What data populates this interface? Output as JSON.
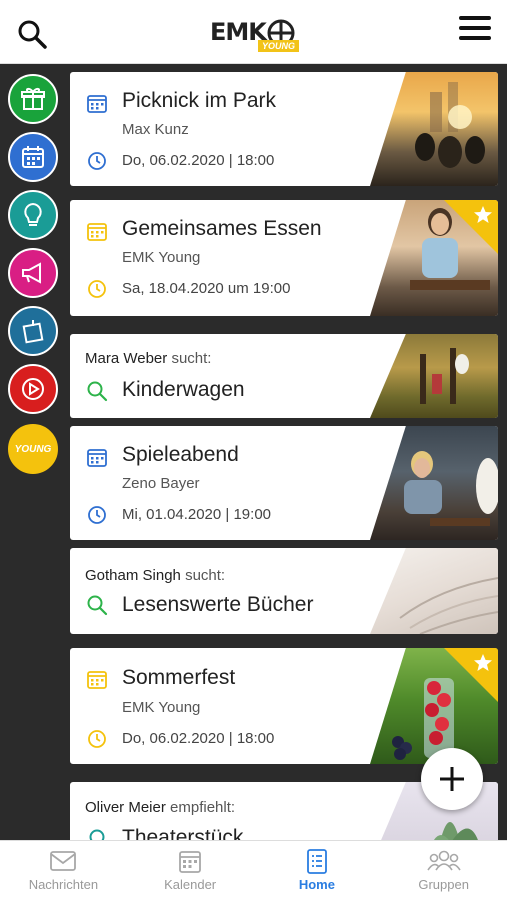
{
  "header": {
    "logo_text": "EMK",
    "logo_badge": "YOUNG"
  },
  "sidebar": {
    "items": [
      {
        "icon": "gift-icon",
        "color": "#19a33b"
      },
      {
        "icon": "calendar-icon",
        "color": "#2f6fd1"
      },
      {
        "icon": "lightbulb-icon",
        "color": "#1a9c96"
      },
      {
        "icon": "megaphone-icon",
        "color": "#d91e84"
      },
      {
        "icon": "note-icon",
        "color": "#1f6f9a"
      },
      {
        "icon": "play-icon",
        "color": "#d81e1e"
      },
      {
        "icon": "young-icon",
        "color": "#f4c20d",
        "label": "YOUNG"
      }
    ]
  },
  "feed": {
    "cards": [
      {
        "type": "event",
        "title": "Picknick im Park",
        "organizer": "Max Kunz",
        "when": "Do, 06.02.2020 | 18:00",
        "accent": "#2f6fd1",
        "featured": false
      },
      {
        "type": "event",
        "title": "Gemeinsames Essen",
        "organizer": "EMK Young",
        "when": "Sa, 18.04.2020 um 19:00",
        "accent": "#f4c20d",
        "featured": true
      },
      {
        "type": "search",
        "poster": "Mara Weber",
        "verb": "sucht:",
        "item": "Kinderwagen"
      },
      {
        "type": "event",
        "title": "Spieleabend",
        "organizer": "Zeno Bayer",
        "when": "Mi, 01.04.2020 | 19:00",
        "accent": "#2f6fd1",
        "featured": false
      },
      {
        "type": "search",
        "poster": "Gotham Singh",
        "verb": "sucht:",
        "item": "Lesenswerte Bücher"
      },
      {
        "type": "event",
        "title": "Sommerfest",
        "organizer": "EMK Young",
        "when": "Do, 06.02.2020 | 18:00",
        "accent": "#f4c20d",
        "featured": true
      },
      {
        "type": "recommend",
        "poster": "Oliver Meier",
        "verb": "empfiehlt:",
        "item": "Theaterstück"
      }
    ]
  },
  "bottom_nav": {
    "items": [
      {
        "label": "Nachrichten",
        "icon": "mail-icon",
        "active": false
      },
      {
        "label": "Kalender",
        "icon": "calendar-icon",
        "active": false
      },
      {
        "label": "Home",
        "icon": "list-icon",
        "active": true
      },
      {
        "label": "Gruppen",
        "icon": "group-icon",
        "active": false
      }
    ]
  },
  "colors": {
    "accent_blue": "#2f6fd1",
    "accent_yellow": "#f4c20d",
    "search_green": "#2db34a",
    "nav_active": "#2a7de1"
  }
}
